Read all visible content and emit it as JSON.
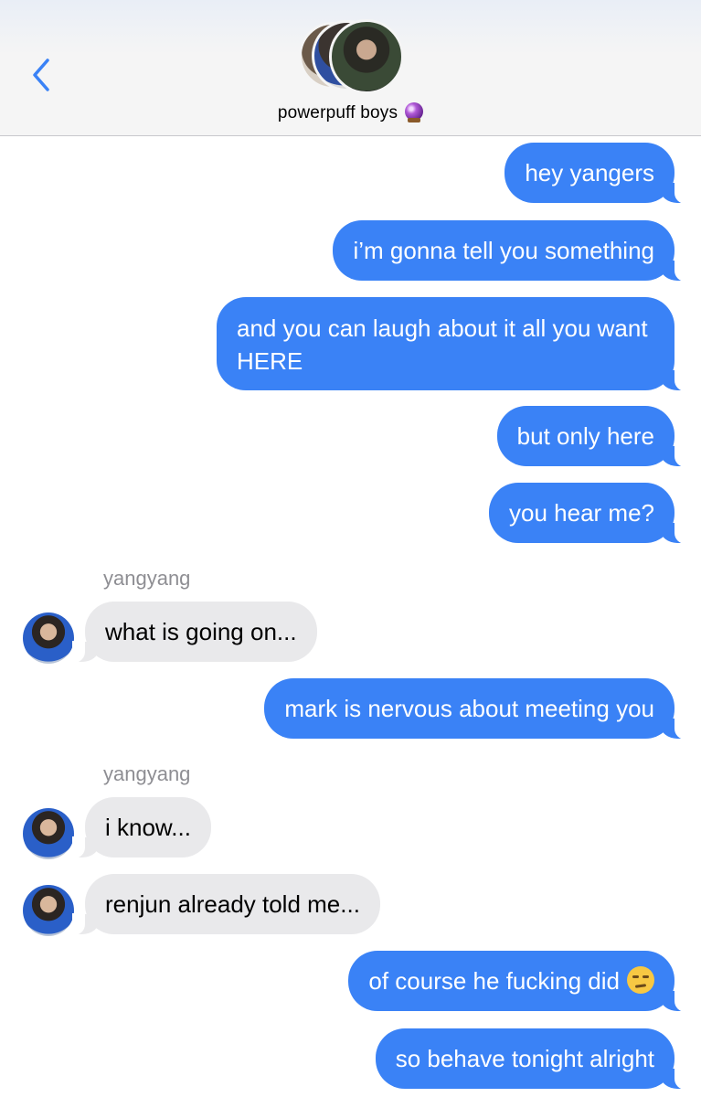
{
  "header": {
    "group_name": "powerpuff boys",
    "back_icon": "chevron-left-icon",
    "group_emoji": "crystal-ball-icon"
  },
  "messages": [
    {
      "dir": "out",
      "text": "hey yangers"
    },
    {
      "dir": "out",
      "text": "i’m gonna tell you something"
    },
    {
      "dir": "out",
      "text": "and you can laugh about it all you want HERE"
    },
    {
      "dir": "out",
      "text": "but only here"
    },
    {
      "dir": "out",
      "text": "you hear me?"
    },
    {
      "dir": "in",
      "sender": "yangyang",
      "text": "what is going on..."
    },
    {
      "dir": "out",
      "text": "mark is nervous about meeting you"
    },
    {
      "dir": "in",
      "sender": "yangyang",
      "text": "i know..."
    },
    {
      "dir": "in",
      "text": "renjun already told me..."
    },
    {
      "dir": "out",
      "text": "of course he fucking did",
      "emoji": "unamused-face-icon"
    },
    {
      "dir": "out",
      "text": "so behave tonight alright"
    }
  ],
  "colors": {
    "outgoing_bubble": "#3a82f6",
    "incoming_bubble": "#e9e9eb",
    "accent": "#3a82f6"
  }
}
